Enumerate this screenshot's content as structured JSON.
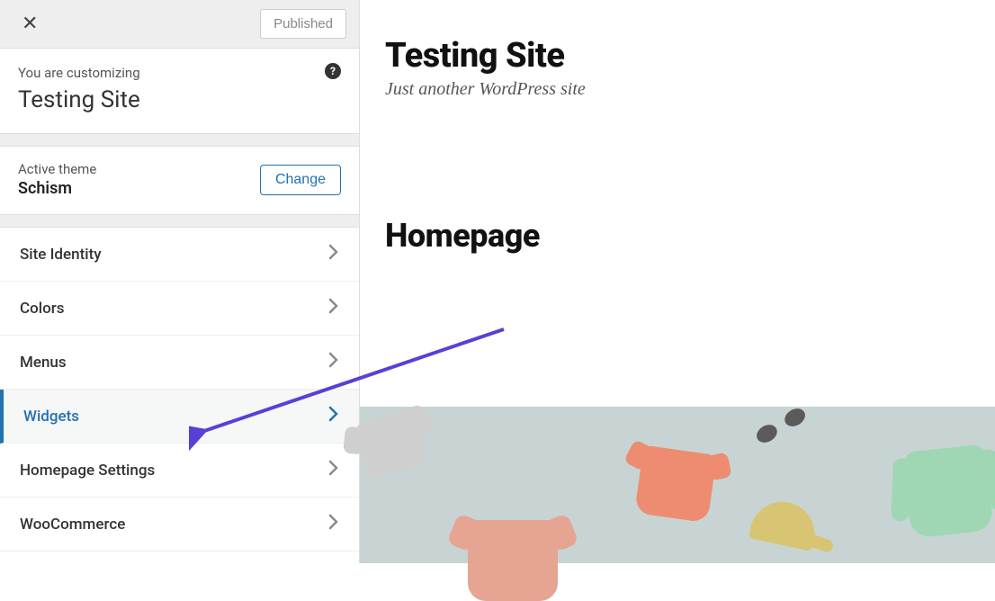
{
  "topbar": {
    "published_label": "Published"
  },
  "context": {
    "label": "You are customizing",
    "title": "Testing Site"
  },
  "theme": {
    "label": "Active theme",
    "name": "Schism",
    "change_label": "Change"
  },
  "sections": [
    {
      "label": "Site Identity",
      "active": false
    },
    {
      "label": "Colors",
      "active": false
    },
    {
      "label": "Menus",
      "active": false
    },
    {
      "label": "Widgets",
      "active": true
    },
    {
      "label": "Homepage Settings",
      "active": false
    },
    {
      "label": "WooCommerce",
      "active": false
    }
  ],
  "preview": {
    "site_title": "Testing Site",
    "tagline": "Just another WordPress site",
    "page_title": "Homepage"
  },
  "annotation": {
    "arrow_color": "#5a3fd6"
  }
}
